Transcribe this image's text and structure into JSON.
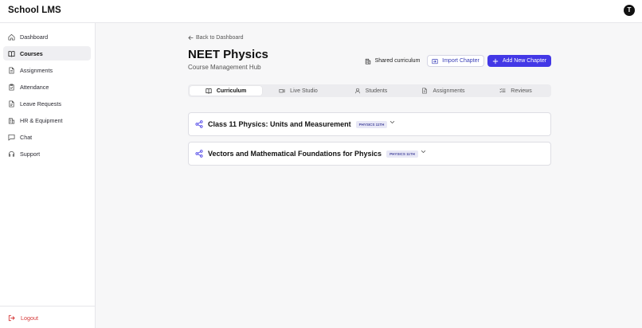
{
  "app": {
    "brand": "School LMS",
    "user_initial": "T"
  },
  "sidebar": {
    "items": [
      {
        "label": "Dashboard",
        "icon": "home-icon"
      },
      {
        "label": "Courses",
        "icon": "book-open-icon",
        "active": true
      },
      {
        "label": "Assignments",
        "icon": "file-text-icon"
      },
      {
        "label": "Attendance",
        "icon": "clipboard-check-icon"
      },
      {
        "label": "Leave Requests",
        "icon": "document-icon"
      },
      {
        "label": "HR & Equipment",
        "icon": "building-icon"
      },
      {
        "label": "Chat",
        "icon": "chat-bubble-icon"
      },
      {
        "label": "Support",
        "icon": "headset-icon"
      }
    ],
    "logout_label": "Logout"
  },
  "page": {
    "back_label": "Back to Dashboard",
    "title": "NEET Physics",
    "subtitle": "Course Management Hub"
  },
  "actions": {
    "shared_label": "Shared curriculum",
    "import_label": "Import Chapter",
    "add_label": "Add New Chapter"
  },
  "tabs": [
    {
      "label": "Curriculum",
      "icon": "book-open-icon",
      "active": true
    },
    {
      "label": "Live Studio",
      "icon": "video-icon"
    },
    {
      "label": "Students",
      "icon": "user-icon"
    },
    {
      "label": "Assignments",
      "icon": "file-text-icon"
    },
    {
      "label": "Reviews",
      "icon": "list-check-icon"
    }
  ],
  "chapters": [
    {
      "name": "Class 11 Physics: Units and Measurement",
      "badge": "PHYSICS 11TH"
    },
    {
      "name": "Vectors and Mathematical Foundations for Physics",
      "badge": "PHYSICS 11TH"
    }
  ],
  "colors": {
    "accent": "#4338e6",
    "logout": "#d63a3a",
    "badge_bg": "#e8e8f6",
    "badge_text": "#4a4aa0"
  }
}
